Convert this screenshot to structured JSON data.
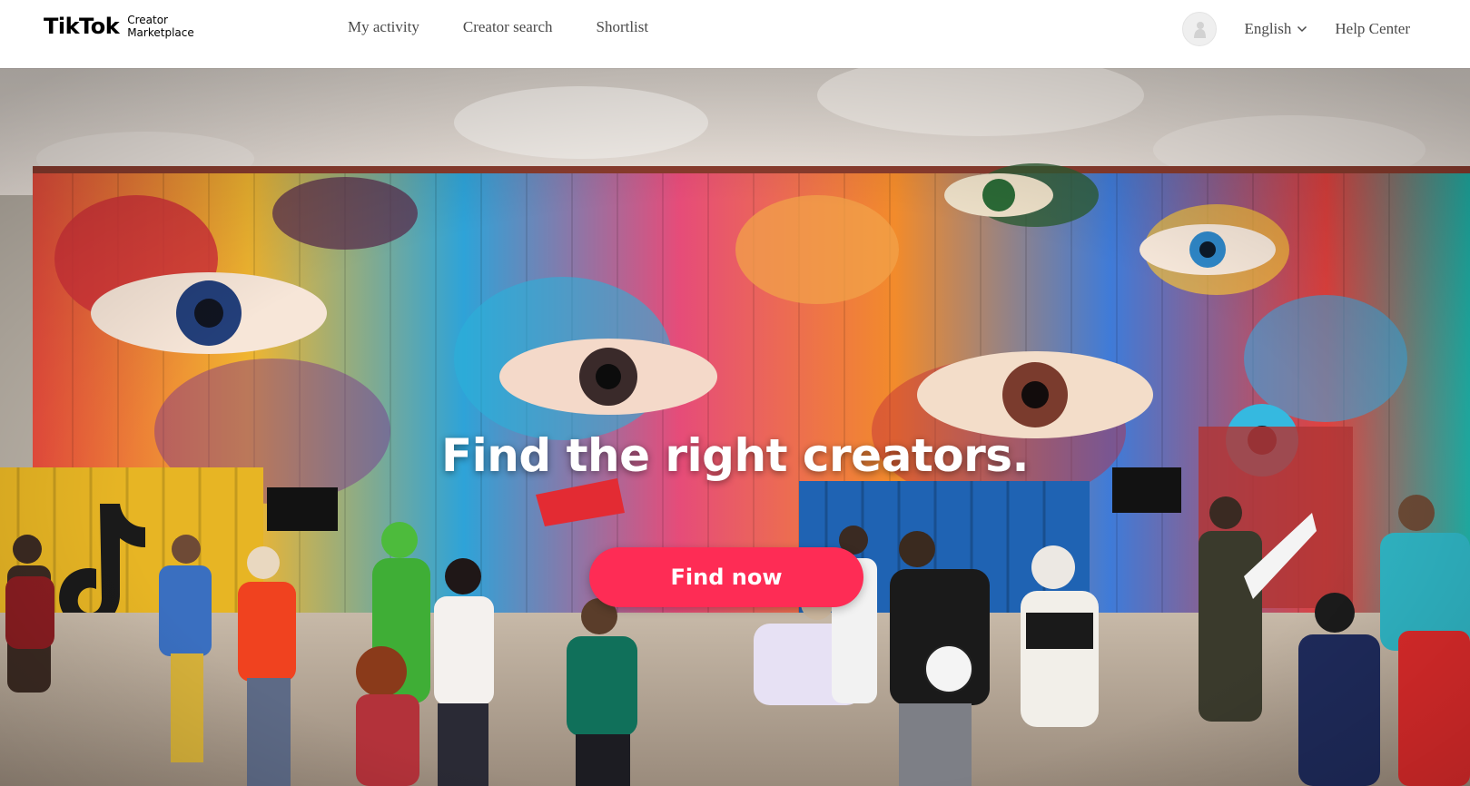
{
  "brand": {
    "wordmark": "TikTok",
    "subtitle_line1": "Creator",
    "subtitle_line2": "Marketplace"
  },
  "nav": {
    "items": [
      {
        "label": "My activity"
      },
      {
        "label": "Creator search"
      },
      {
        "label": "Shortlist"
      }
    ]
  },
  "header_right": {
    "avatar_icon": "user-silhouette-icon",
    "language": "English",
    "help": "Help Center"
  },
  "hero": {
    "title": "Find the right creators.",
    "cta_label": "Find now",
    "cta_color": "#fe2c55",
    "background_description_icon": "mural-crowd-photo"
  },
  "colors": {
    "accent": "#fe2c55",
    "nav_text": "#4a4a4a",
    "tiktok_cyan": "#25f4ee"
  }
}
